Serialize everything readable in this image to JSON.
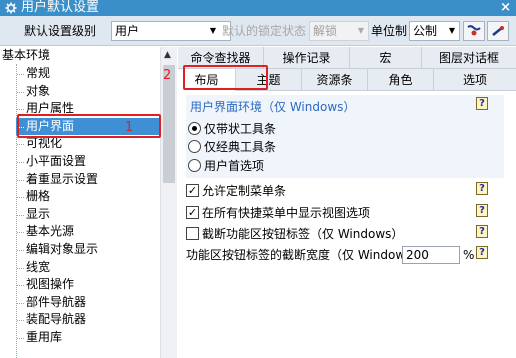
{
  "window": {
    "title": "用户默认设置",
    "close": "×"
  },
  "toolbar": {
    "level_label": "默认设置级别",
    "level_value": "用户",
    "lock_label": "默认的锁定状态",
    "lock_value": "解锁",
    "unit_label": "单位制",
    "unit_value": "公制"
  },
  "tree": {
    "root": "基本环境",
    "items": [
      "常规",
      "对象",
      "用户属性",
      "用户界面",
      "可视化",
      "小平面设置",
      "着重显示设置",
      "栅格",
      "显示",
      "基本光源",
      "编辑对象显示",
      "线宽",
      "视图操作",
      "部件导航器",
      "装配导航器",
      "重用库"
    ],
    "selected_index": 3
  },
  "annotations": {
    "a1": "1",
    "a2": "2"
  },
  "tabs_top": [
    "命令查找器",
    "操作记录",
    "宏",
    "图层对话框"
  ],
  "tabs_bottom": [
    "布局",
    "主题",
    "资源条",
    "角色",
    "选项"
  ],
  "active_tab": "布局",
  "layout": {
    "group_title": "用户界面环境（仅 Windows）",
    "radios": [
      "仅带状工具条",
      "仅经典工具条",
      "用户首选项"
    ],
    "radio_selected": 0,
    "checks": [
      {
        "label": "允许定制菜单条",
        "checked": true
      },
      {
        "label": "在所有快捷菜单中显示视图选项",
        "checked": true
      },
      {
        "label": "截断功能区按钮标签（仅 Windows）",
        "checked": false
      }
    ],
    "truncate_label": "功能区按钮标签的截断宽度（仅 Window",
    "truncate_value": "200",
    "truncate_unit": "%",
    "help": "?"
  }
}
